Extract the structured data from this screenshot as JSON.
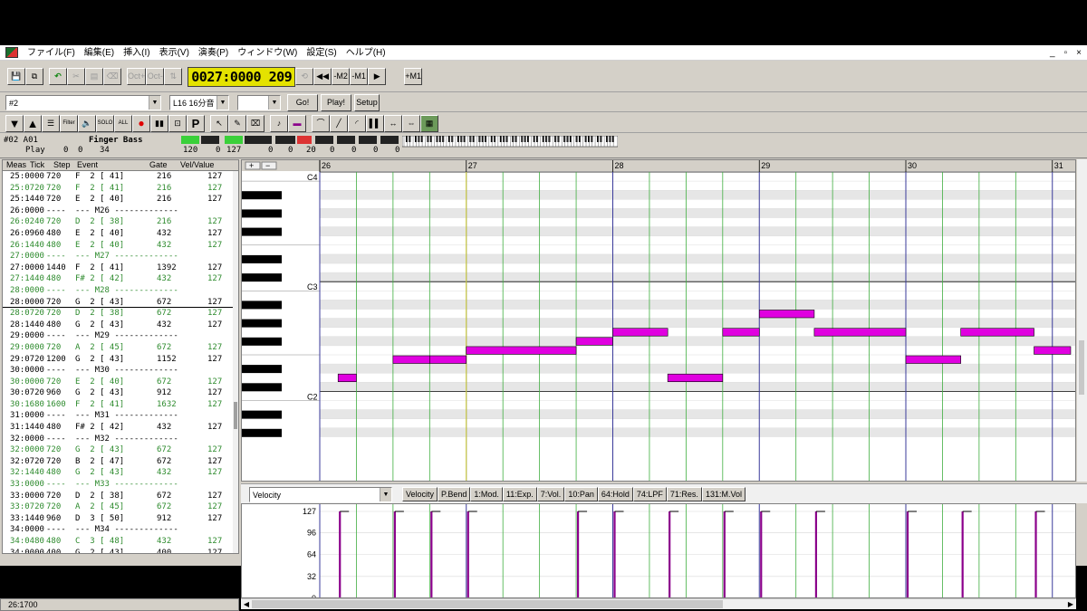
{
  "menu": [
    "ファイル(F)",
    "編集(E)",
    "挿入(I)",
    "表示(V)",
    "演奏(P)",
    "ウィンドウ(W)",
    "設定(S)",
    "ヘルプ(H)"
  ],
  "window_controls": [
    "_",
    "▫",
    "×"
  ],
  "toolbar1": {
    "oct_plus": "Oct+",
    "oct_minus": "Oct-",
    "position": "0027:0000",
    "tempo": "209",
    "m2": "-M2",
    "m1": "-M1",
    "play": "▶",
    "plus_m1": "+M1"
  },
  "toolbar2": {
    "track_select": "#2",
    "quantize_select": "L16 16分音",
    "go": "Go!",
    "play": "Play!",
    "setup": "Setup"
  },
  "toolbar3": {
    "filter": "Filter",
    "solo": "SOLO",
    "all": "ALL",
    "p": "P"
  },
  "track_info": {
    "track": "#02 A01",
    "instrument": "Finger Bass",
    "mode": "Play",
    "v1": "0",
    "v2": "0",
    "v3": "34",
    "v4": "120",
    "v5": "0",
    "v6": "127",
    "v7": "0",
    "v8": "0",
    "v9": "20",
    "v10": "0",
    "v11": "0",
    "v12": "0",
    "v13": "0"
  },
  "event_list": {
    "headers": [
      "Meas",
      "Tick",
      "Step",
      "Event",
      "Gate",
      "Vel/Value"
    ],
    "rows": [
      {
        "pos": "25:0000",
        "step": "720",
        "event": "F  2 [ 41]",
        "gate": "216",
        "vel": "127",
        "color": "#000000"
      },
      {
        "pos": "25:0720",
        "step": "720",
        "event": "F  2 [ 41]",
        "gate": "216",
        "vel": "127",
        "color": "#2e8b2e"
      },
      {
        "pos": "25:1440",
        "step": "720",
        "event": "E  2 [ 40]",
        "gate": "216",
        "vel": "127",
        "color": "#000000"
      },
      {
        "pos": "26:0000",
        "step": "----",
        "event": "--- M26 -------------",
        "gate": "",
        "vel": "",
        "color": "#000000"
      },
      {
        "pos": "26:0240",
        "step": "720",
        "event": "D  2 [ 38]",
        "gate": "216",
        "vel": "127",
        "color": "#2e8b2e"
      },
      {
        "pos": "26:0960",
        "step": "480",
        "event": "E  2 [ 40]",
        "gate": "432",
        "vel": "127",
        "color": "#000000"
      },
      {
        "pos": "26:1440",
        "step": "480",
        "event": "E  2 [ 40]",
        "gate": "432",
        "vel": "127",
        "color": "#2e8b2e"
      },
      {
        "pos": "27:0000",
        "step": "----",
        "event": "--- M27 -------------",
        "gate": "",
        "vel": "",
        "color": "#2e8b2e"
      },
      {
        "pos": "27:0000",
        "step": "1440",
        "event": "F  2 [ 41]",
        "gate": "1392",
        "vel": "127",
        "color": "#000000"
      },
      {
        "pos": "27:1440",
        "step": "480",
        "event": "F# 2 [ 42]",
        "gate": "432",
        "vel": "127",
        "color": "#2e8b2e"
      },
      {
        "pos": "28:0000",
        "step": "----",
        "event": "--- M28 -------------",
        "gate": "",
        "vel": "",
        "color": "#2e8b2e"
      },
      {
        "pos": "28:0000",
        "step": "720",
        "event": "G  2 [ 43]",
        "gate": "672",
        "vel": "127",
        "color": "#000000"
      },
      {
        "pos": "28:0720",
        "step": "720",
        "event": "D  2 [ 38]",
        "gate": "672",
        "vel": "127",
        "color": "#2e8b2e"
      },
      {
        "pos": "28:1440",
        "step": "480",
        "event": "G  2 [ 43]",
        "gate": "432",
        "vel": "127",
        "color": "#000000"
      },
      {
        "pos": "29:0000",
        "step": "----",
        "event": "--- M29 -------------",
        "gate": "",
        "vel": "",
        "color": "#000000"
      },
      {
        "pos": "29:0000",
        "step": "720",
        "event": "A  2 [ 45]",
        "gate": "672",
        "vel": "127",
        "color": "#2e8b2e"
      },
      {
        "pos": "29:0720",
        "step": "1200",
        "event": "G  2 [ 43]",
        "gate": "1152",
        "vel": "127",
        "color": "#000000"
      },
      {
        "pos": "30:0000",
        "step": "----",
        "event": "--- M30 -------------",
        "gate": "",
        "vel": "",
        "color": "#000000"
      },
      {
        "pos": "30:0000",
        "step": "720",
        "event": "E  2 [ 40]",
        "gate": "672",
        "vel": "127",
        "color": "#2e8b2e"
      },
      {
        "pos": "30:0720",
        "step": "960",
        "event": "G  2 [ 43]",
        "gate": "912",
        "vel": "127",
        "color": "#000000"
      },
      {
        "pos": "30:1680",
        "step": "1600",
        "event": "F  2 [ 41]",
        "gate": "1632",
        "vel": "127",
        "color": "#2e8b2e"
      },
      {
        "pos": "31:0000",
        "step": "----",
        "event": "--- M31 -------------",
        "gate": "",
        "vel": "",
        "color": "#000000"
      },
      {
        "pos": "31:1440",
        "step": "480",
        "event": "F# 2 [ 42]",
        "gate": "432",
        "vel": "127",
        "color": "#000000"
      },
      {
        "pos": "32:0000",
        "step": "----",
        "event": "--- M32 -------------",
        "gate": "",
        "vel": "",
        "color": "#000000"
      },
      {
        "pos": "32:0000",
        "step": "720",
        "event": "G  2 [ 43]",
        "gate": "672",
        "vel": "127",
        "color": "#2e8b2e"
      },
      {
        "pos": "32:0720",
        "step": "720",
        "event": "B  2 [ 47]",
        "gate": "672",
        "vel": "127",
        "color": "#000000"
      },
      {
        "pos": "32:1440",
        "step": "480",
        "event": "G  2 [ 43]",
        "gate": "432",
        "vel": "127",
        "color": "#2e8b2e"
      },
      {
        "pos": "33:0000",
        "step": "----",
        "event": "--- M33 -------------",
        "gate": "",
        "vel": "",
        "color": "#2e8b2e"
      },
      {
        "pos": "33:0000",
        "step": "720",
        "event": "D  2 [ 38]",
        "gate": "672",
        "vel": "127",
        "color": "#000000"
      },
      {
        "pos": "33:0720",
        "step": "720",
        "event": "A  2 [ 45]",
        "gate": "672",
        "vel": "127",
        "color": "#2e8b2e"
      },
      {
        "pos": "33:1440",
        "step": "960",
        "event": "D  3 [ 50]",
        "gate": "912",
        "vel": "127",
        "color": "#000000"
      },
      {
        "pos": "34:0000",
        "step": "----",
        "event": "--- M34 -------------",
        "gate": "",
        "vel": "",
        "color": "#000000"
      },
      {
        "pos": "34:0480",
        "step": "480",
        "event": "C  3 [ 48]",
        "gate": "432",
        "vel": "127",
        "color": "#2e8b2e"
      },
      {
        "pos": "34:0000",
        "step": "400",
        "event": "G  2 [ 43]",
        "gate": "400",
        "vel": "127",
        "color": "#000000"
      }
    ]
  },
  "piano_roll": {
    "ruler": [
      "26",
      "27",
      "28",
      "29",
      "30",
      "31"
    ],
    "octave_labels": [
      "C4",
      "C3",
      "C2"
    ],
    "note_color": "#e000e0",
    "notes": [
      {
        "start": 26.125,
        "len": 0.125,
        "pitch": 38
      },
      {
        "start": 26.5,
        "len": 0.25,
        "pitch": 40
      },
      {
        "start": 26.75,
        "len": 0.25,
        "pitch": 40
      },
      {
        "start": 27.0,
        "len": 0.75,
        "pitch": 41
      },
      {
        "start": 27.75,
        "len": 0.25,
        "pitch": 42
      },
      {
        "start": 28.0,
        "len": 0.375,
        "pitch": 43
      },
      {
        "start": 28.375,
        "len": 0.375,
        "pitch": 38
      },
      {
        "start": 28.75,
        "len": 0.25,
        "pitch": 43
      },
      {
        "start": 29.0,
        "len": 0.375,
        "pitch": 45
      },
      {
        "start": 29.375,
        "len": 0.625,
        "pitch": 43
      },
      {
        "start": 30.0,
        "len": 0.375,
        "pitch": 40
      },
      {
        "start": 30.375,
        "len": 0.5,
        "pitch": 43
      },
      {
        "start": 30.875,
        "len": 0.25,
        "pitch": 41
      }
    ]
  },
  "controller": {
    "select": "Velocity",
    "tabs": [
      "Velocity",
      "P.Bend",
      "1:Mod.",
      "11:Exp.",
      "7:Vol.",
      "10:Pan",
      "64:Hold",
      "74:LPF",
      "71:Res.",
      "131:M.Vol"
    ],
    "scale": [
      "127",
      "96",
      "64",
      "32",
      "0"
    ]
  },
  "status": {
    "position": "26:1700"
  }
}
